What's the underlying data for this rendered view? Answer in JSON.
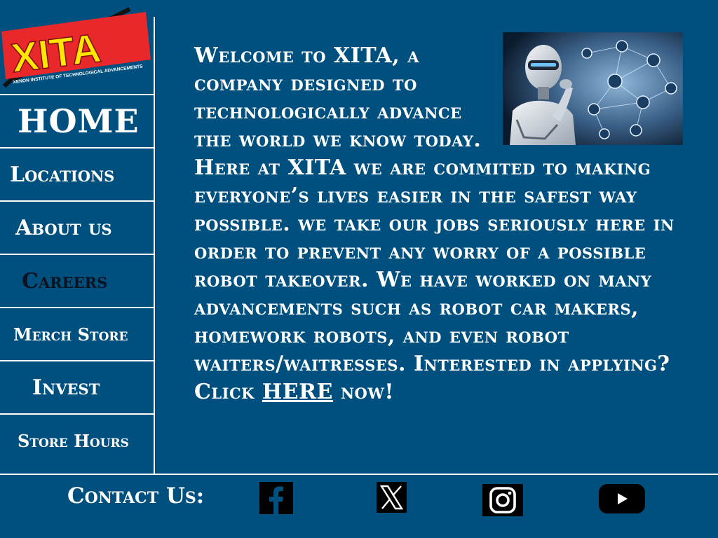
{
  "logo": {
    "text": "XITA",
    "tagline": "XENON INSTITUTE OF TECHNOLOGICAL ADVANCEMENTS"
  },
  "nav": {
    "home": "HOME",
    "locations": "Locations",
    "about": "About us",
    "careers": "Careers",
    "merch": "Merch Store",
    "invest": "Invest",
    "hours": "Store Hours"
  },
  "main": {
    "body_text": "Welcome to XITA, a company designed to technologically advance the world we know today. Here at XITA we are commited to making everyone’s lives easier in the safest way possible. we take our jobs seriously here in order to prevent any worry of a possible robot takeover. We have worked on many advancements such as robot car makers, homework robots, and even robot waiters/waitresses. Interested in applying? Click",
    "link_text": "HERE",
    "tail_text": " now!"
  },
  "footer": {
    "contact_label": "Contact Us:",
    "social": [
      "facebook-icon",
      "x-icon",
      "instagram-icon",
      "youtube-icon"
    ]
  },
  "colors": {
    "background": "#00507f",
    "logo_red": "#e8282b",
    "logo_yellow": "#ffe600",
    "careers_text": "#0b1320"
  }
}
